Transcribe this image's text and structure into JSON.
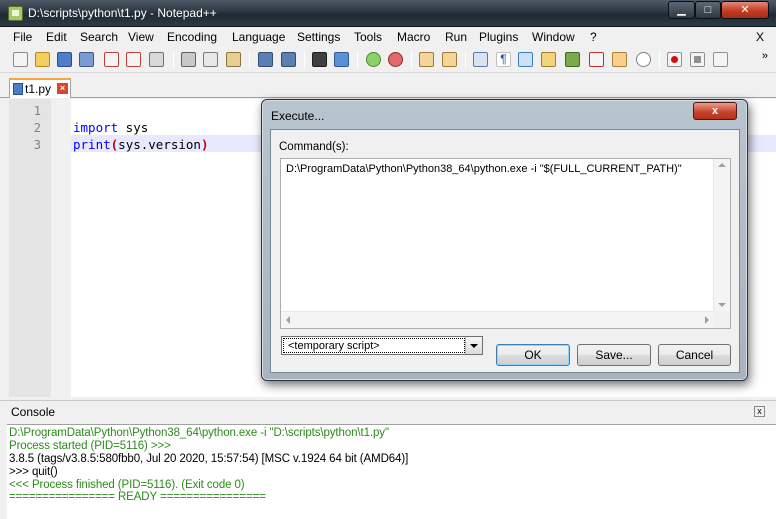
{
  "window": {
    "title": "D:\\scripts\\python\\t1.py - Notepad++"
  },
  "menu": {
    "items": [
      "File",
      "Edit",
      "Search",
      "View",
      "Encoding",
      "Language",
      "Settings",
      "Tools",
      "Macro",
      "Run",
      "Plugins",
      "Window",
      "?"
    ],
    "close_label": "X"
  },
  "toolbar": {
    "more_label": "»",
    "icons": [
      "new-file-icon",
      "open-file-icon",
      "save-icon",
      "save-all-icon",
      "close-icon",
      "close-all-icon",
      "print-icon",
      "cut-icon",
      "copy-icon",
      "paste-icon",
      "undo-icon",
      "redo-icon",
      "find-icon",
      "replace-icon",
      "zoom-in-icon",
      "zoom-out-icon",
      "sync-vertical-icon",
      "sync-horizontal-icon",
      "word-wrap-icon",
      "show-all-chars-icon",
      "indent-guide-icon",
      "doc-map-icon",
      "function-list-icon",
      "folder-workspace-icon",
      "monitoring-icon",
      "record-macro-icon",
      "stop-macro-icon",
      "play-macro-icon"
    ]
  },
  "tabs": [
    {
      "label": "t1.py",
      "close": "×"
    }
  ],
  "editor": {
    "line_numbers": [
      "1",
      "2",
      "3"
    ],
    "line2": {
      "kw": "import",
      "rest": " sys"
    },
    "line3": {
      "fn": "print",
      "open": "(",
      "arg": "sys.version",
      "close": ")"
    }
  },
  "dialog": {
    "title": "Execute...",
    "close_label": "x",
    "command_label": "Command(s):",
    "command_text": "D:\\ProgramData\\Python\\Python38_64\\python.exe -i \"$(FULL_CURRENT_PATH)\"",
    "script_select": "<temporary script>",
    "ok_label": "OK",
    "save_label": "Save...",
    "cancel_label": "Cancel"
  },
  "console": {
    "title": "Console",
    "close_label": "x",
    "lines": [
      {
        "text": "D:\\ProgramData\\Python\\Python38_64\\python.exe -i \"D:\\scripts\\python\\t1.py\"",
        "color": "green"
      },
      {
        "text": "Process started (PID=5116) >>>",
        "color": "green"
      },
      {
        "text": "3.8.5 (tags/v3.8.5:580fbb0, Jul 20 2020, 15:57:54) [MSC v.1924 64 bit (AMD64)]",
        "color": "black"
      },
      {
        "text": ">>> quit()",
        "color": "black"
      },
      {
        "text": "<<< Process finished (PID=5116). (Exit code 0)",
        "color": "green"
      },
      {
        "text": "================ READY ================",
        "color": "green"
      }
    ]
  },
  "colors": {
    "keyword": "#0000ff",
    "console_green": "#2a8b1a",
    "tab_accent": "#f7a73b",
    "current_line": "#e8e8ff"
  }
}
